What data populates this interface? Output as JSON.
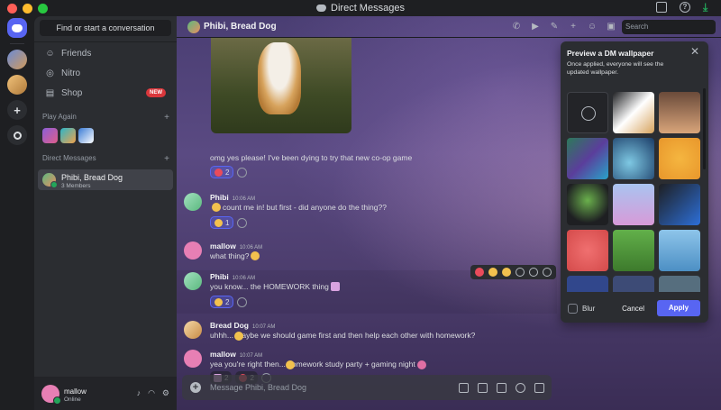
{
  "window": {
    "title": "Direct Messages"
  },
  "colors": {
    "accent": "#5865f2",
    "online": "#23a55a",
    "danger": "#da373c"
  },
  "sidebar": {
    "search_placeholder": "Find or start a conversation",
    "items": [
      {
        "label": "Friends",
        "icon": "friends-icon"
      },
      {
        "label": "Nitro",
        "icon": "nitro-icon"
      },
      {
        "label": "Shop",
        "icon": "shop-icon",
        "badge": "NEW"
      }
    ],
    "play_again": "Play Again",
    "direct_messages": "Direct Messages",
    "dm": {
      "name": "Phibi, Bread Dog",
      "members": "3 Members"
    }
  },
  "user": {
    "name": "mallow",
    "status": "Online"
  },
  "header": {
    "title": "Phibi, Bread Dog",
    "search_placeholder": "Search"
  },
  "messages": [
    {
      "author": "",
      "time": "",
      "text": "omg yes please! I've been dying to try that new co-op game",
      "reactions": [
        {
          "count": "2"
        }
      ]
    },
    {
      "author": "Phibi",
      "time": "10:06 AM",
      "text": "count me in! but first - did anyone do the thing??",
      "reactions": [
        {
          "count": "1"
        }
      ]
    },
    {
      "author": "mallow",
      "time": "10:06 AM",
      "text": "what thing?",
      "reactions": []
    },
    {
      "author": "Phibi",
      "time": "10:06 AM",
      "text": "you know... the HOMEWORK thing",
      "reactions": [
        {
          "count": "2"
        }
      ]
    },
    {
      "author": "Bread Dog",
      "time": "10:07 AM",
      "text": "uhhh...   maybe we should game first and then help each other with homework?",
      "reactions": []
    },
    {
      "author": "mallow",
      "time": "10:07 AM",
      "text": "yea you're right    then... homework study party + gaming night",
      "reactions": [
        {
          "count": "2"
        },
        {
          "count": "2"
        }
      ]
    }
  ],
  "composer": {
    "placeholder": "Message Phibi, Bread Dog"
  },
  "wallpaper_panel": {
    "title": "Preview a DM wallpaper",
    "description": "Once applied, everyone will see the updated wallpaper.",
    "blur_label": "Blur",
    "cancel_label": "Cancel",
    "apply_label": "Apply"
  }
}
